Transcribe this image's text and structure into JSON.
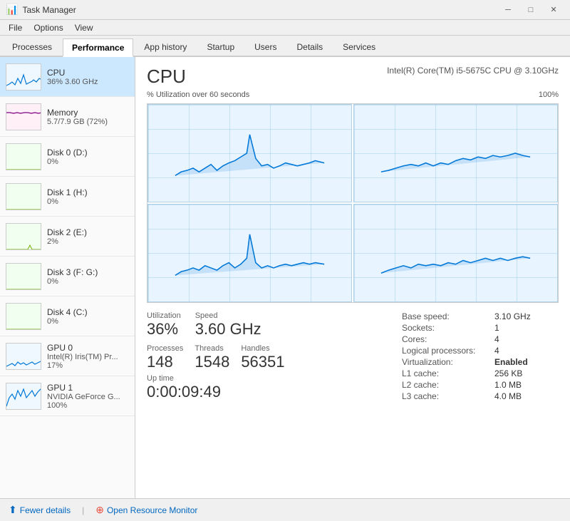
{
  "titleBar": {
    "title": "Task Manager",
    "icon": "⚙"
  },
  "menu": {
    "items": [
      "File",
      "Options",
      "View"
    ]
  },
  "tabs": {
    "items": [
      "Processes",
      "Performance",
      "App history",
      "Startup",
      "Users",
      "Details",
      "Services"
    ],
    "active": "Performance"
  },
  "sidebar": {
    "items": [
      {
        "name": "CPU",
        "sub": "36% 3.60 GHz",
        "type": "cpu",
        "active": true
      },
      {
        "name": "Memory",
        "sub": "5.7/7.9 GB (72%)",
        "type": "mem",
        "active": false
      },
      {
        "name": "Disk 0 (D:)",
        "sub": "0%",
        "type": "disk",
        "active": false
      },
      {
        "name": "Disk 1 (H:)",
        "sub": "0%",
        "type": "disk",
        "active": false
      },
      {
        "name": "Disk 2 (E:)",
        "sub": "2%",
        "type": "disk",
        "active": false
      },
      {
        "name": "Disk 3 (F: G:)",
        "sub": "0%",
        "type": "disk",
        "active": false
      },
      {
        "name": "Disk 4 (C:)",
        "sub": "0%",
        "type": "disk",
        "active": false
      },
      {
        "name": "GPU 0",
        "sub": "Intel(R) Iris(TM) Pr...\n17%",
        "sub1": "Intel(R) Iris(TM) Pr...",
        "sub2": "17%",
        "type": "gpu",
        "active": false
      },
      {
        "name": "GPU 1",
        "sub": "NVIDIA GeForce G...\n100%",
        "sub1": "NVIDIA GeForce G...",
        "sub2": "100%",
        "type": "gpu1",
        "active": false
      }
    ]
  },
  "cpuPanel": {
    "title": "CPU",
    "model": "Intel(R) Core(TM) i5-5675C CPU @ 3.10GHz",
    "graphLabel": "% Utilization over 60 seconds",
    "graphLabelRight": "100%",
    "stats": {
      "utilization_label": "Utilization",
      "utilization_value": "36%",
      "speed_label": "Speed",
      "speed_value": "3.60 GHz",
      "processes_label": "Processes",
      "processes_value": "148",
      "threads_label": "Threads",
      "threads_value": "1548",
      "handles_label": "Handles",
      "handles_value": "56351",
      "uptime_label": "Up time",
      "uptime_value": "0:00:09:49"
    },
    "rightStats": {
      "base_speed_label": "Base speed:",
      "base_speed_value": "3.10 GHz",
      "sockets_label": "Sockets:",
      "sockets_value": "1",
      "cores_label": "Cores:",
      "cores_value": "4",
      "logical_label": "Logical processors:",
      "logical_value": "4",
      "virt_label": "Virtualization:",
      "virt_value": "Enabled",
      "l1_label": "L1 cache:",
      "l1_value": "256 KB",
      "l2_label": "L2 cache:",
      "l2_value": "1.0 MB",
      "l3_label": "L3 cache:",
      "l3_value": "4.0 MB"
    }
  },
  "bottomBar": {
    "fewer_label": "Fewer details",
    "monitor_label": "Open Resource Monitor"
  }
}
